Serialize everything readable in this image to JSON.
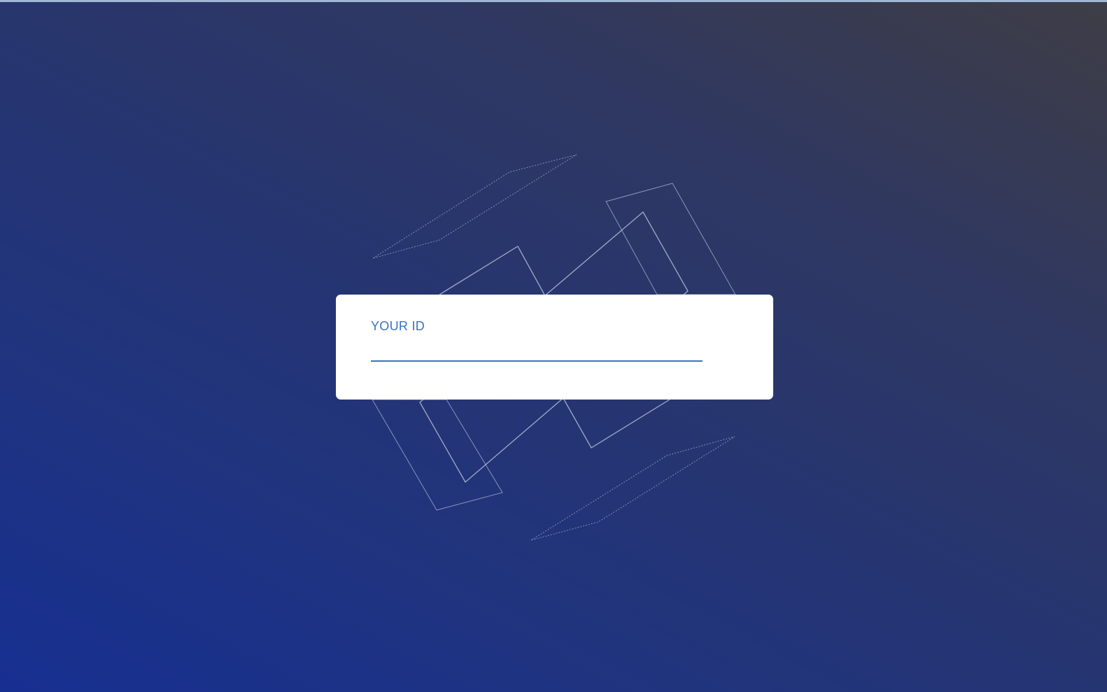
{
  "login": {
    "id_label": "YOUR ID",
    "id_value": "",
    "id_placeholder": ""
  },
  "colors": {
    "accent": "#3a72c2",
    "card_background": "#ffffff",
    "background_start": "#172f91",
    "background_end": "#3e3e47",
    "line_art": "#c9d2e6"
  }
}
